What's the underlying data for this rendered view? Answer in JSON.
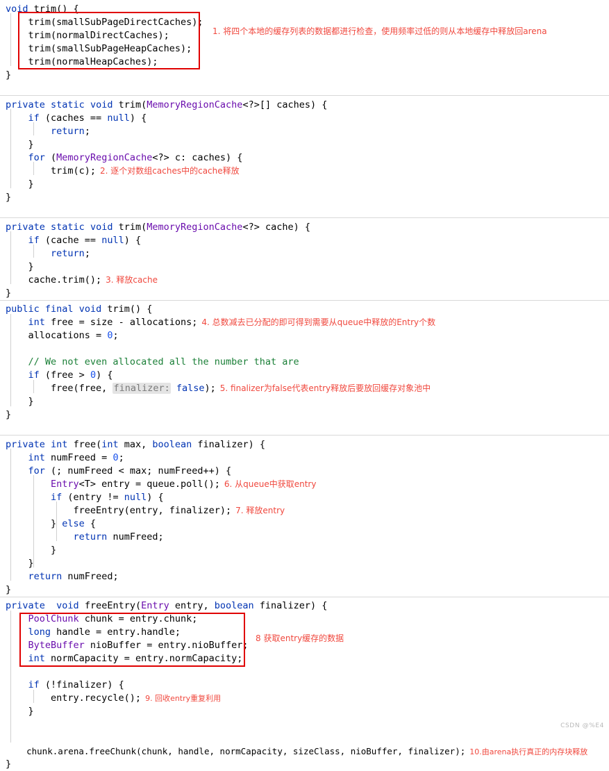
{
  "watermark": "CSDN @%E4",
  "annotations": {
    "a1": "1. 将四个本地的缓存列表的数据都进行检查，使用频率过低的则从本地缓存中释放回arena",
    "a2": "2. 逐个对数组caches中的cache释放",
    "a3": "3. 释放cache",
    "a4": "4. 总数减去已分配的即可得到需要从queue中释放的Entry个数",
    "a5": "5. finalizer为false代表entry释放后要放回缓存对象池中",
    "a6": "6. 从queue中获取entry",
    "a7": "7. 释放entry",
    "a8": "8 获取entry缓存的数据",
    "a9": "9. 回收entry重复利用",
    "a10": "10.由arena执行真正的内存块释放"
  },
  "blocks": [
    {
      "name": "trim-void-block",
      "lines": [
        "void trim() {",
        "    trim(smallSubPageDirectCaches);",
        "    trim(normalDirectCaches);",
        "    trim(smallSubPageHeapCaches);",
        "    trim(normalHeapCaches);",
        "}"
      ]
    },
    {
      "name": "trim-array-block",
      "lines": [
        "private static void trim(MemoryRegionCache<?>[] caches) {",
        "    if (caches == null) {",
        "        return;",
        "    }",
        "    for (MemoryRegionCache<?> c: caches) {",
        "        trim(c);",
        "    }",
        "}"
      ]
    },
    {
      "name": "trim-single-block",
      "lines": [
        "private static void trim(MemoryRegionCache<?> cache) {",
        "    if (cache == null) {",
        "        return;",
        "    }",
        "    cache.trim();",
        "}"
      ]
    },
    {
      "name": "trim-final-block",
      "lines": [
        "public final void trim() {",
        "    int free = size - allocations;",
        "    allocations = 0;",
        "",
        "    // We not even allocated all the number that are",
        "    if (free > 0) {",
        "        free(free, finalizer: false);",
        "    }",
        "}"
      ]
    },
    {
      "name": "free-block",
      "lines": [
        "private int free(int max, boolean finalizer) {",
        "    int numFreed = 0;",
        "    for (; numFreed < max; numFreed++) {",
        "        Entry<T> entry = queue.poll();",
        "        if (entry != null) {",
        "            freeEntry(entry, finalizer);",
        "        } else {",
        "            return numFreed;",
        "        }",
        "    }",
        "    return numFreed;",
        "}"
      ]
    },
    {
      "name": "free-entry-block",
      "lines": [
        "private  void freeEntry(Entry entry, boolean finalizer) {",
        "    PoolChunk chunk = entry.chunk;",
        "    long handle = entry.handle;",
        "    ByteBuffer nioBuffer = entry.nioBuffer;",
        "    int normCapacity = entry.normCapacity;",
        "",
        "    if (!finalizer) {",
        "        entry.recycle();",
        "    }",
        "",
        "",
        "    chunk.arena.freeChunk(chunk, handle, normCapacity, sizeClass, nioBuffer, finalizer);",
        "}"
      ]
    }
  ]
}
